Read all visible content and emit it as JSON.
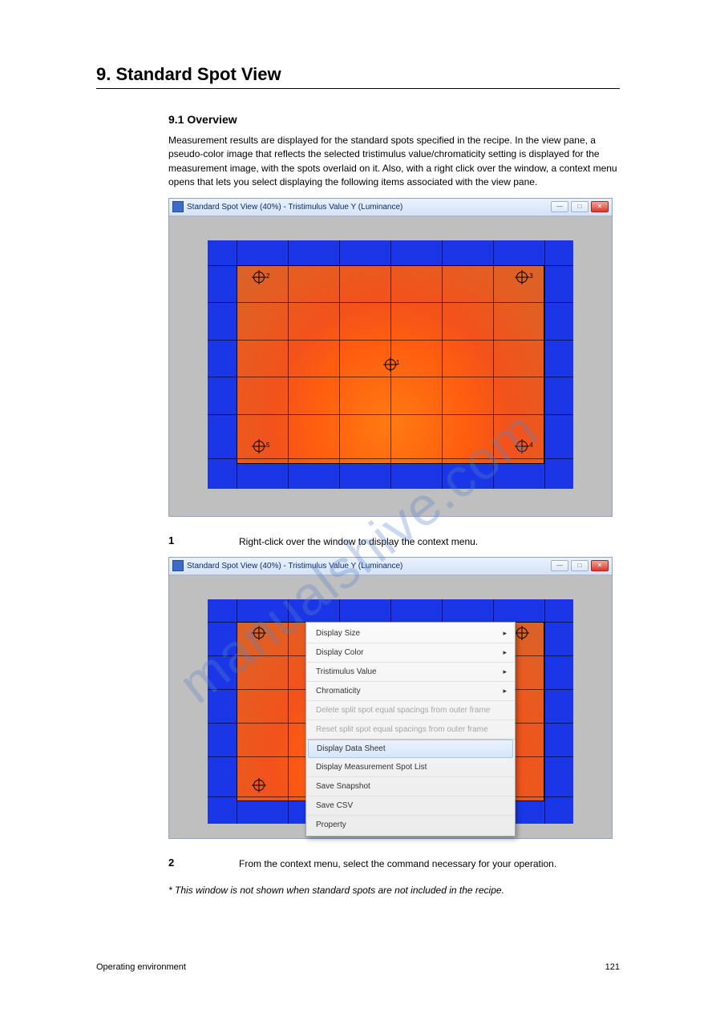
{
  "page": {
    "heading": "9. Standard Spot View",
    "section1_title": "9.1 Overview",
    "overview_para": "Measurement results are displayed for the standard spots specified in the recipe. In the view pane, a pseudo-color image that reflects the selected tristimulus value/chromaticity setting is displayed for the measurement image, with the spots overlaid on it. Also, with a right click over the window, a context menu opens that lets you select displaying the following items associated with the view pane.",
    "step1_label": "1",
    "step1_text": "Right-click over the window to display the context menu.",
    "step2_label": "2",
    "step2_text": "From the context menu, select the command necessary for your operation.",
    "footnote_italic": "* This window is not shown when standard spots are not included in the recipe."
  },
  "window": {
    "title": "Standard Spot View (40%) - Tristimulus Value Y (Luminance)",
    "min_label": "—",
    "max_label": "□",
    "close_label": "✕"
  },
  "spots": {
    "s1": "1",
    "s2": "2",
    "s3": "3",
    "s4": "4",
    "s5": "5"
  },
  "context_menu": {
    "display_size": "Display Size",
    "display_color": "Display Color",
    "tristimulus": "Tristimulus Value",
    "chromaticity": "Chromaticity",
    "delete_split": "Delete split spot equal spacings from outer frame",
    "reset_split": "Reset split spot equal spacings from outer frame",
    "display_data_sheet": "Display Data Sheet",
    "display_spot_list": "Display Measurement Spot List",
    "save_snapshot": "Save Snapshot",
    "save_csv": "Save CSV",
    "property": "Property"
  },
  "footer": {
    "left": "Operating environment",
    "right": "121"
  },
  "watermark": "manualshive.com"
}
